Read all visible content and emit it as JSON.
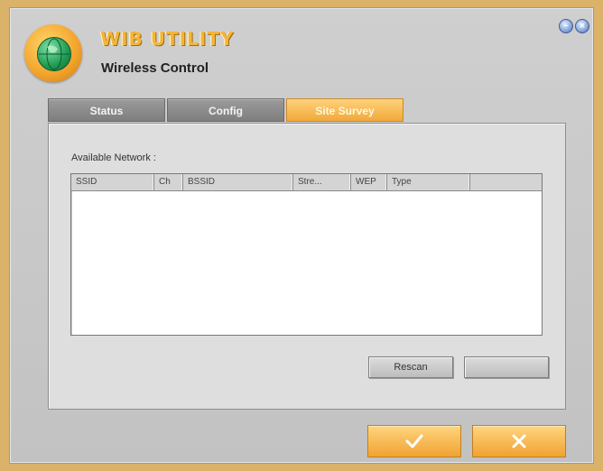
{
  "app": {
    "title": "WIB UTILITY",
    "subtitle": "Wireless Control"
  },
  "window_controls": {
    "minimize_icon": "minimize-icon",
    "close_icon": "close-icon"
  },
  "tabs": [
    {
      "label": "Status",
      "active": false
    },
    {
      "label": "Config",
      "active": false
    },
    {
      "label": "Site Survey",
      "active": true
    }
  ],
  "site_survey": {
    "list_label": "Available Network :",
    "columns": [
      "SSID",
      "Ch",
      "BSSID",
      "Stre...",
      "WEP",
      "Type"
    ],
    "rows": [],
    "rescan_label": "Rescan",
    "connect_label": "..."
  },
  "footer": {
    "ok_icon": "checkmark-icon",
    "cancel_icon": "x-icon"
  },
  "colors": {
    "accent": "#f2a93a",
    "background": "#c8c8c8",
    "frame": "#dab26a"
  }
}
